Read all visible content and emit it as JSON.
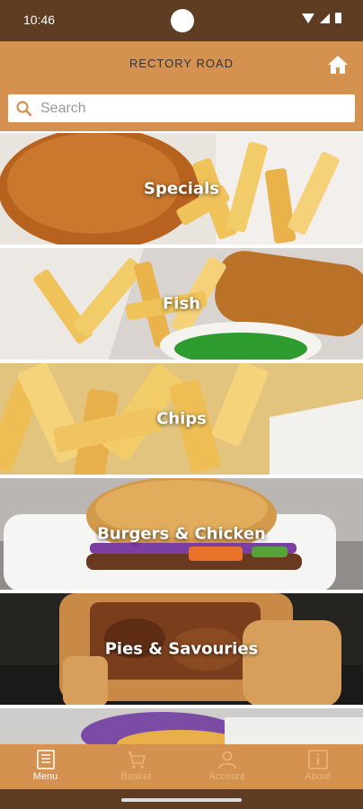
{
  "status_bar": {
    "time": "10:46",
    "icons": [
      "wifi-icon",
      "signal-icon",
      "battery-icon"
    ]
  },
  "header": {
    "title": "RECTORY ROAD",
    "home_icon": "home-icon"
  },
  "search": {
    "placeholder": "Search",
    "value": ""
  },
  "categories": [
    {
      "label": "Specials"
    },
    {
      "label": "Fish"
    },
    {
      "label": "Chips"
    },
    {
      "label": "Burgers & Chicken"
    },
    {
      "label": "Pies & Savouries"
    },
    {
      "label": ""
    }
  ],
  "tabs": [
    {
      "label": "Menu",
      "icon": "menu-book-icon",
      "active": true
    },
    {
      "label": "Basket",
      "icon": "basket-icon",
      "active": false
    },
    {
      "label": "Account",
      "icon": "account-icon",
      "active": false
    },
    {
      "label": "About",
      "icon": "info-icon",
      "active": false
    }
  ],
  "colors": {
    "brand": "#d4914f",
    "status_bar": "#5e3d22",
    "inactive_tab": "#e9b57e"
  }
}
